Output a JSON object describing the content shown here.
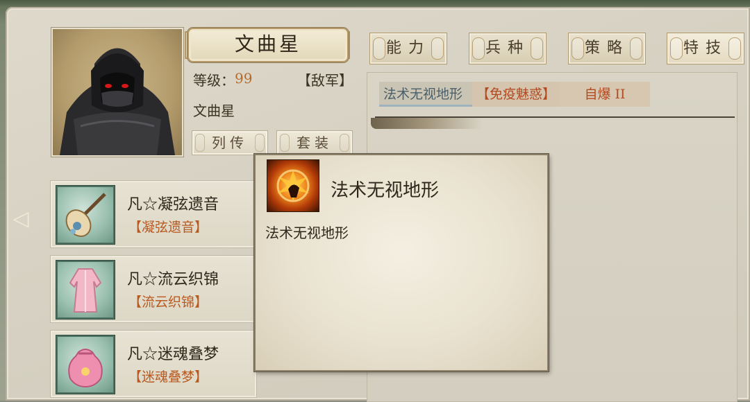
{
  "character": {
    "name": "文曲星",
    "level_label": "等级：",
    "level": "99",
    "faction": "【敌军】",
    "subtitle": "文曲星"
  },
  "buttons": {
    "biography": "列传",
    "equipment_set": "套装"
  },
  "equipment": [
    {
      "name": "凡☆凝弦遗音",
      "set": "【凝弦遗音】",
      "icon": "pipa-icon"
    },
    {
      "name": "凡☆流云织锦",
      "set": "【流云织锦】",
      "icon": "robe-icon"
    },
    {
      "name": "凡☆迷魂叠梦",
      "set": "【迷魂叠梦】",
      "icon": "pouch-icon"
    }
  ],
  "tabs": [
    {
      "label": "能力",
      "id": "ability"
    },
    {
      "label": "兵种",
      "id": "unit-type"
    },
    {
      "label": "策略",
      "id": "strategy"
    },
    {
      "label": "特技",
      "id": "special-skill",
      "active": true
    }
  ],
  "skills": [
    {
      "label": "法术无视地形",
      "selected": true
    },
    {
      "label": "【免疫魅惑】"
    },
    {
      "label": "自爆 II"
    }
  ],
  "tooltip": {
    "title": "法术无视地形",
    "description": "法术无视地形",
    "icon": "fire-explosion-icon"
  },
  "colors": {
    "level": "#b56a2c",
    "set_name": "#b85a1f",
    "skill_highlight": "#b04b22"
  }
}
